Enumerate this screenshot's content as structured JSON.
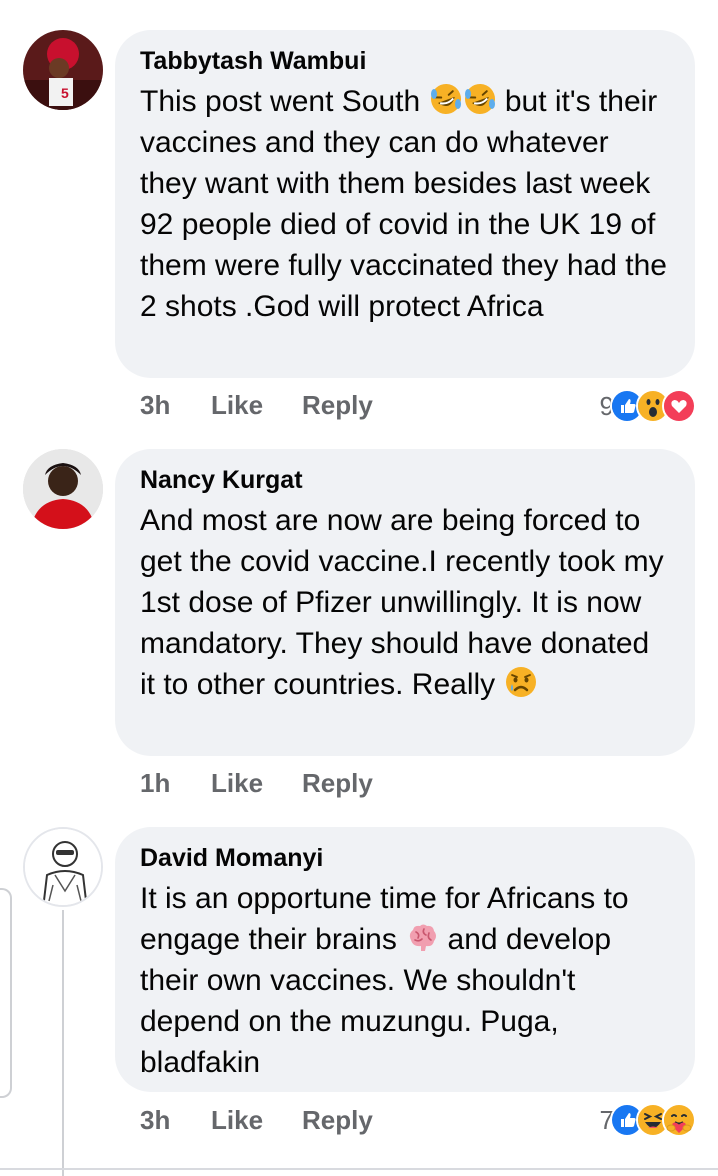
{
  "comments": [
    {
      "author": "Tabbytash Wambui",
      "text_before_emoji": "This post went South ",
      "text_after_emoji": " but it's their vaccines and they can do whatever they want with them besides last week 92 people died of covid in the UK 19 of them were fully vaccinated they had the 2 shots .God will protect Africa",
      "emoji": [
        "rofl-emoji",
        "rofl-emoji"
      ],
      "time": "3h",
      "like_label": "Like",
      "reply_label": "Reply",
      "reaction_count": "9",
      "reactions": [
        "like-reaction-icon",
        "wow-reaction-icon",
        "love-reaction-icon"
      ]
    },
    {
      "author": "Nancy Kurgat",
      "text_before_emoji": "And most are now are being forced to get the covid vaccine.I recently took my 1st dose of Pfizer unwillingly. It is now mandatory. They should have donated it to other countries. Really ",
      "emoji": [
        "crying-face-emoji"
      ],
      "time": "1h",
      "like_label": "Like",
      "reply_label": "Reply"
    },
    {
      "author": "David Momanyi",
      "text_before_emoji": "It is an opportune time for Africans to engage their brains ",
      "text_after_emoji": " and develop their own vaccines. We shouldn't depend on the muzungu. Puga, bladfakin",
      "emoji": [
        "brain-emoji"
      ],
      "time": "3h",
      "like_label": "Like",
      "reply_label": "Reply",
      "reaction_count": "7",
      "reactions": [
        "like-reaction-icon",
        "haha-reaction-icon",
        "care-reaction-icon"
      ]
    }
  ],
  "colors": {
    "bubble": "#f0f2f5",
    "meta_text": "#65676b",
    "like_blue": "#1877f2",
    "love_red": "#f33e58",
    "emoji_yellow": "#f7b125"
  }
}
